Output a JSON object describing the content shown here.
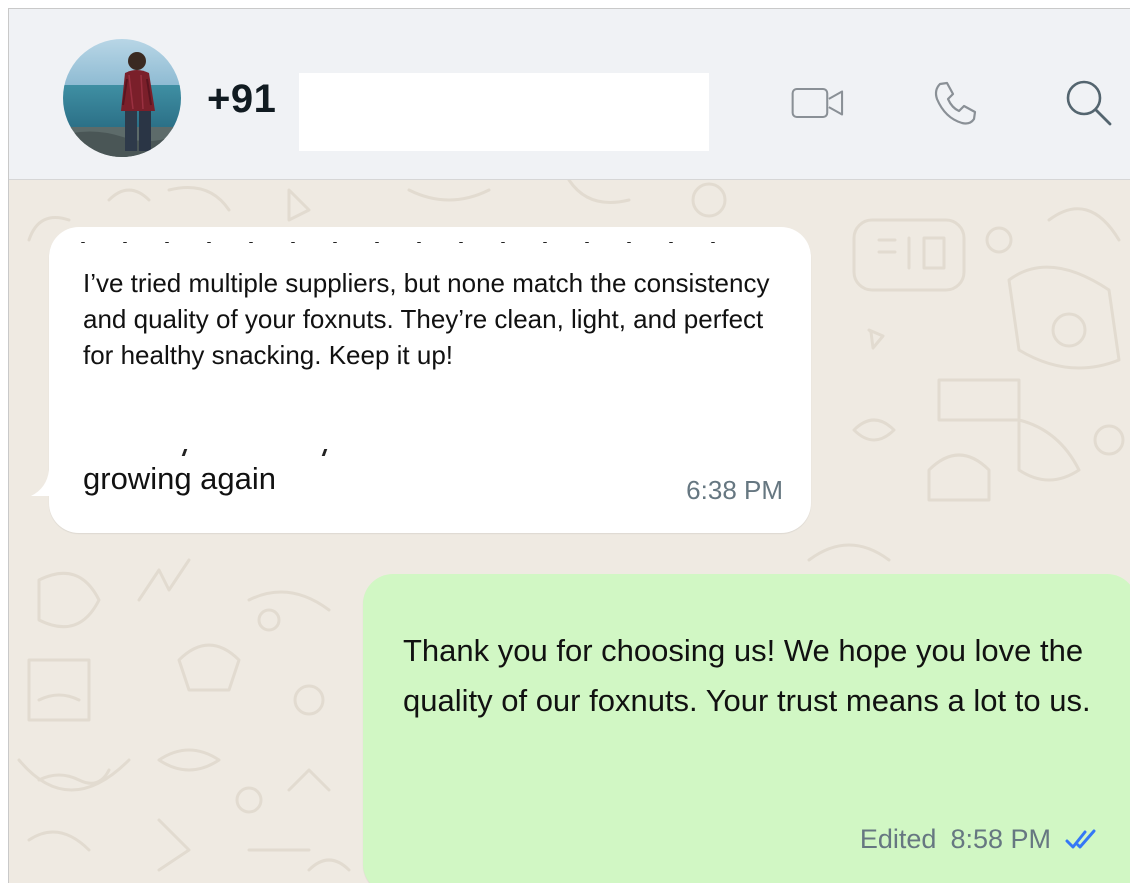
{
  "header": {
    "contact_name": "+91",
    "icons": [
      "video-call-icon",
      "voice-call-icon",
      "search-icon"
    ]
  },
  "messages": [
    {
      "direction": "incoming",
      "text": "I’ve tried multiple suppliers, but none match the consistency and quality of your foxnuts. They’re clean, light, and perfect for healthy snacking. Keep it up!",
      "footer_text": "growing again",
      "time": "6:38 PM"
    },
    {
      "direction": "outgoing",
      "text": "Thank you for choosing us! We hope you love the quality of our foxnuts. Your trust means a lot to us.",
      "edited_label": "Edited",
      "time": "8:58 PM",
      "status": "read"
    }
  ],
  "colors": {
    "header_bg": "#f0f2f5",
    "chat_bg": "#efeae2",
    "incoming_bubble": "#ffffff",
    "outgoing_bubble": "#d1f7c4",
    "read_tick": "#3478f6",
    "meta_text": "#667781"
  }
}
